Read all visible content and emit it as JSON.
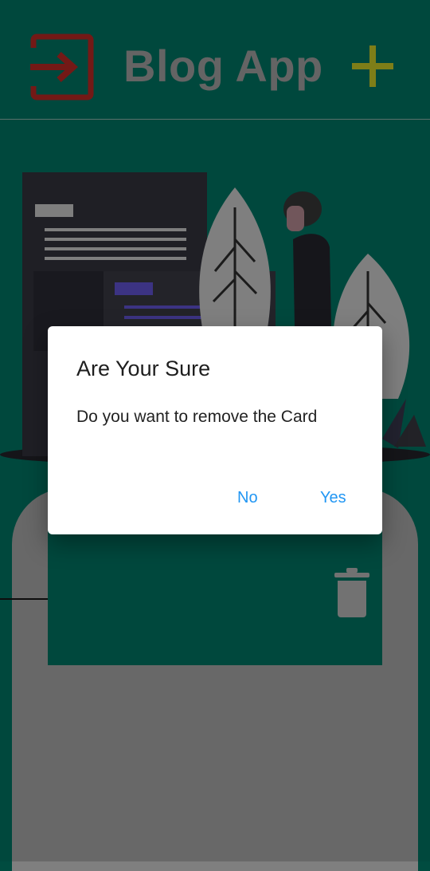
{
  "appbar": {
    "title": "Blog App",
    "logout_icon": "logout-icon",
    "add_icon": "add-icon"
  },
  "colors": {
    "background": "#00584b",
    "accent": "#2196f3",
    "logout": "#8d1f1c",
    "add": "#9a9a1e"
  },
  "card": {
    "delete_icon": "trash-icon"
  },
  "dialog": {
    "title": "Are Your Sure",
    "message": "Do you want to remove the Card",
    "no_label": "No",
    "yes_label": "Yes"
  }
}
